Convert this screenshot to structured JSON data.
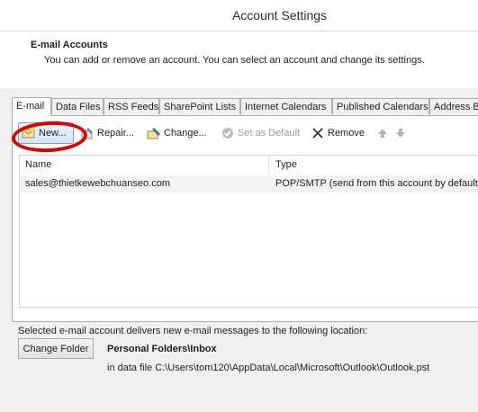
{
  "window": {
    "title": "Account Settings"
  },
  "header": {
    "title": "E-mail Accounts",
    "description": "You can add or remove an account. You can select an account and change its settings."
  },
  "tabs": [
    {
      "label": "E-mail"
    },
    {
      "label": "Data Files"
    },
    {
      "label": "RSS Feeds"
    },
    {
      "label": "SharePoint Lists"
    },
    {
      "label": "Internet Calendars"
    },
    {
      "label": "Published Calendars"
    },
    {
      "label": "Address B"
    }
  ],
  "toolbar": {
    "new_label": "New...",
    "repair_label": "Repair...",
    "change_label": "Change...",
    "set_default_label": "Set as Default",
    "remove_label": "Remove"
  },
  "accounts_list": {
    "columns": [
      "Name",
      "Type"
    ],
    "rows": [
      {
        "name": "sales@thietkewebchuanseo.com",
        "type": "POP/SMTP (send from this account by default)"
      }
    ]
  },
  "delivery": {
    "text": "Selected e-mail account delivers new e-mail messages to the following location:",
    "change_folder_label": "Change Folder",
    "folder_name": "Personal Folders\\Inbox",
    "data_file_path": "in data file C:\\Users\\tom120\\AppData\\Local\\Microsoft\\Outlook\\Outlook.pst"
  },
  "colors": {
    "highlight_circle": "#e00000",
    "selected_row": "#f3f3f3"
  },
  "icons": [
    "new-account-icon",
    "repair-icon",
    "change-icon",
    "set-default-icon",
    "remove-icon",
    "move-up-icon",
    "move-down-icon"
  ]
}
